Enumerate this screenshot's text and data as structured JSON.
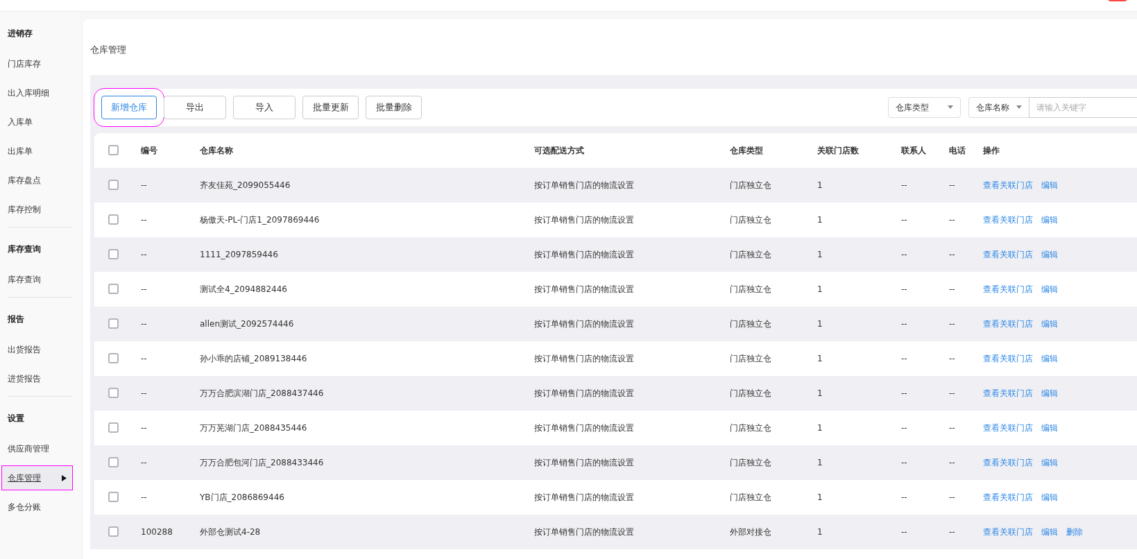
{
  "page_title": "仓库管理",
  "sidebar": [
    {
      "title": "进销存",
      "items": [
        {
          "label": "门店库存",
          "selected": false,
          "highlighted": false
        },
        {
          "label": "出入库明细",
          "selected": false,
          "highlighted": false
        },
        {
          "label": "入库单",
          "selected": false,
          "highlighted": false
        },
        {
          "label": "出库单",
          "selected": false,
          "highlighted": false
        },
        {
          "label": "库存盘点",
          "selected": false,
          "highlighted": false
        },
        {
          "label": "库存控制",
          "selected": false,
          "highlighted": false
        }
      ]
    },
    {
      "title": "库存查询",
      "items": [
        {
          "label": "库存查询",
          "selected": false,
          "highlighted": false
        }
      ]
    },
    {
      "title": "报告",
      "items": [
        {
          "label": "出货报告",
          "selected": false,
          "highlighted": false
        },
        {
          "label": "进货报告",
          "selected": false,
          "highlighted": false
        }
      ]
    },
    {
      "title": "设置",
      "items": [
        {
          "label": "供应商管理",
          "selected": false,
          "highlighted": false
        },
        {
          "label": "仓库管理",
          "selected": true,
          "highlighted": true
        },
        {
          "label": "多仓分账",
          "selected": false,
          "highlighted": false
        }
      ]
    }
  ],
  "toolbar": {
    "buttons": [
      {
        "label": "新增仓库",
        "kind": "primary",
        "highlighted": true
      },
      {
        "label": "导出",
        "kind": "default",
        "highlighted": false
      },
      {
        "label": "导入",
        "kind": "default",
        "highlighted": false
      },
      {
        "label": "批量更新",
        "kind": "default",
        "highlighted": false
      },
      {
        "label": "批量删除",
        "kind": "default",
        "highlighted": false
      }
    ],
    "type_select": {
      "value": "仓库类型"
    },
    "field_select": {
      "value": "仓库名称"
    },
    "search": {
      "placeholder": "请输入关键字"
    }
  },
  "table": {
    "header_checked": false,
    "columns": [
      "编号",
      "仓库名称",
      "可选配送方式",
      "仓库类型",
      "关联门店数",
      "联系人",
      "电话",
      "操作"
    ],
    "rows": [
      {
        "checked": false,
        "cells": [
          "--",
          "齐友佳苑_2099055446",
          "按订单销售门店的物流设置",
          "门店独立仓",
          "1",
          "--",
          "--"
        ],
        "actions": [
          "查看关联门店",
          "编辑"
        ]
      },
      {
        "checked": false,
        "cells": [
          "--",
          "杨傲天-PL-门店1_2097869446",
          "按订单销售门店的物流设置",
          "门店独立仓",
          "1",
          "--",
          "--"
        ],
        "actions": [
          "查看关联门店",
          "编辑"
        ]
      },
      {
        "checked": false,
        "cells": [
          "--",
          "1111_2097859446",
          "按订单销售门店的物流设置",
          "门店独立仓",
          "1",
          "--",
          "--"
        ],
        "actions": [
          "查看关联门店",
          "编辑"
        ]
      },
      {
        "checked": false,
        "cells": [
          "--",
          "测试全4_2094882446",
          "按订单销售门店的物流设置",
          "门店独立仓",
          "1",
          "--",
          "--"
        ],
        "actions": [
          "查看关联门店",
          "编辑"
        ]
      },
      {
        "checked": false,
        "cells": [
          "--",
          "allen测试_2092574446",
          "按订单销售门店的物流设置",
          "门店独立仓",
          "1",
          "--",
          "--"
        ],
        "actions": [
          "查看关联门店",
          "编辑"
        ]
      },
      {
        "checked": false,
        "cells": [
          "--",
          "孙小乖的店铺_2089138446",
          "按订单销售门店的物流设置",
          "门店独立仓",
          "1",
          "--",
          "--"
        ],
        "actions": [
          "查看关联门店",
          "编辑"
        ]
      },
      {
        "checked": false,
        "cells": [
          "--",
          "万万合肥滨湖门店_2088437446",
          "按订单销售门店的物流设置",
          "门店独立仓",
          "1",
          "--",
          "--"
        ],
        "actions": [
          "查看关联门店",
          "编辑"
        ]
      },
      {
        "checked": false,
        "cells": [
          "--",
          "万万芜湖门店_2088435446",
          "按订单销售门店的物流设置",
          "门店独立仓",
          "1",
          "--",
          "--"
        ],
        "actions": [
          "查看关联门店",
          "编辑"
        ]
      },
      {
        "checked": false,
        "cells": [
          "--",
          "万万合肥包河门店_2088433446",
          "按订单销售门店的物流设置",
          "门店独立仓",
          "1",
          "--",
          "--"
        ],
        "actions": [
          "查看关联门店",
          "编辑"
        ]
      },
      {
        "checked": false,
        "cells": [
          "--",
          "YB门店_2086869446",
          "按订单销售门店的物流设置",
          "门店独立仓",
          "1",
          "--",
          "--"
        ],
        "actions": [
          "查看关联门店",
          "编辑"
        ]
      },
      {
        "checked": false,
        "cells": [
          "100288",
          "外部仓测试4-28",
          "按订单销售门店的物流设置",
          "外部对接仓",
          "1",
          "--",
          "--"
        ],
        "actions": [
          "查看关联门店",
          "编辑",
          "删除"
        ]
      }
    ]
  }
}
